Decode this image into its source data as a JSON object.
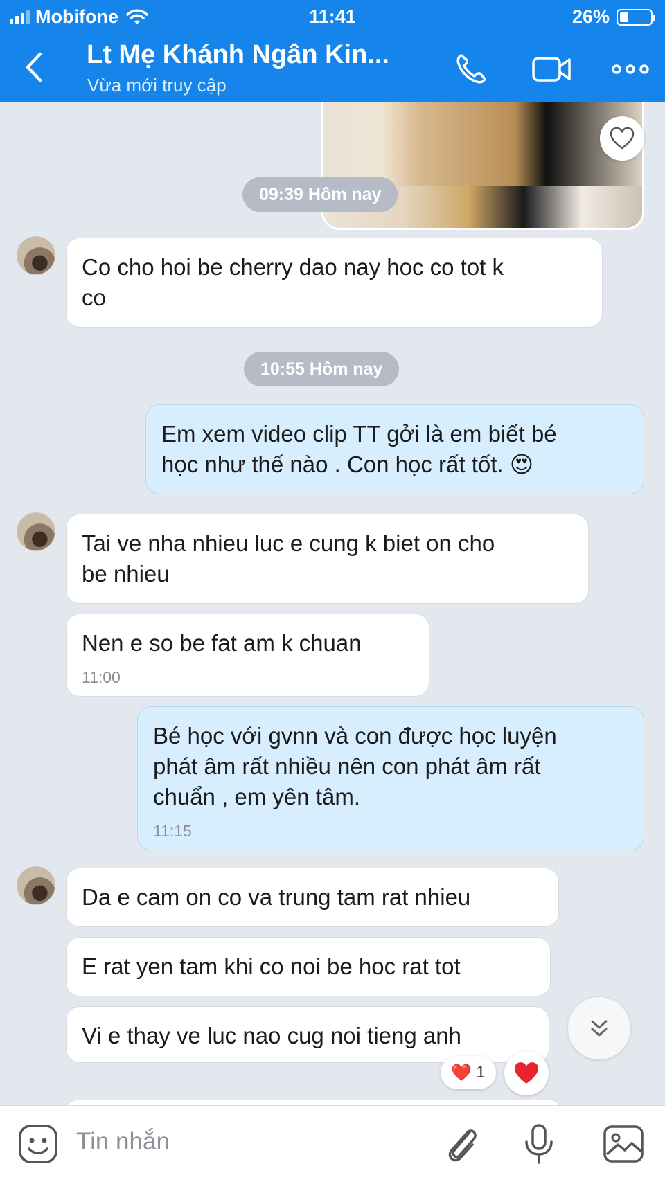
{
  "status_bar": {
    "carrier": "Mobifone",
    "time": "11:41",
    "battery": "26%"
  },
  "header": {
    "title": "Lt Mẹ Khánh Ngân Kin...",
    "subtitle": "Vừa mới truy cập"
  },
  "chat": {
    "timestamps": [
      "09:39 Hôm nay",
      "10:55 Hôm nay"
    ],
    "messages": [
      {
        "from": "them",
        "text_1": "Co cho hoi be cherry dao nay hoc co tot k",
        "text_2": "co"
      },
      {
        "from": "me",
        "text_1": "Em xem video clip TT gởi là em biết bé",
        "text_2": "học như thế nào . Con học rất tốt. 😍"
      },
      {
        "from": "them",
        "text_1": "Tai ve nha nhieu luc e cung k biet on cho",
        "text_2": "be nhieu"
      },
      {
        "from": "them",
        "text_1": "Nen e so be fat am k chuan",
        "time": "11:00"
      },
      {
        "from": "me",
        "text_1": "Bé học với gvnn và con được học luyện",
        "text_2": "phát âm rất nhiều nên con phát âm rất",
        "text_3": "chuẩn , em yên tâm.",
        "time": "11:15"
      },
      {
        "from": "them",
        "text_1": "Da e cam on co va trung tam rat nhieu"
      },
      {
        "from": "them",
        "text_1": "E rat yen tam khi co noi be hoc rat tot"
      },
      {
        "from": "them",
        "text_1": "Vi e thay ve luc nao cug noi tieng anh"
      }
    ],
    "reaction": {
      "emoji": "❤️",
      "count": "1"
    }
  },
  "input": {
    "placeholder": "Tin nhắn"
  },
  "colors": {
    "header": "#1585ec",
    "chat_bg": "#e3e8ef",
    "my_bubble": "#d6eefd",
    "their_bubble": "#ffffff"
  },
  "icons": [
    "back-icon",
    "phone-icon",
    "video-call-icon",
    "more-icon",
    "heart-icon",
    "chevron-double-down-icon",
    "emoji-icon",
    "attach-icon",
    "mic-icon",
    "gallery-icon"
  ]
}
